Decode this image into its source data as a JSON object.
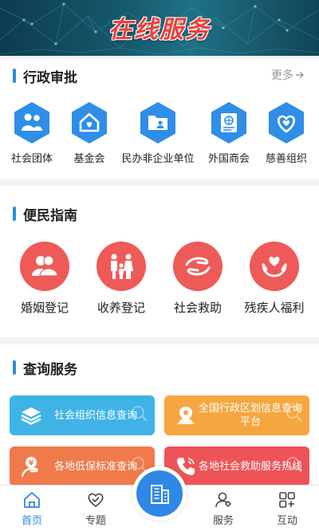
{
  "banner": {
    "title": "在线服务"
  },
  "approval": {
    "title": "行政审批",
    "more": "更多",
    "items": [
      {
        "label": "社会团体",
        "icon": "people-icon"
      },
      {
        "label": "基金会",
        "icon": "house-heart-icon"
      },
      {
        "label": "民办非企业单位",
        "icon": "folder-person-icon"
      },
      {
        "label": "外国商会",
        "icon": "document-globe-icon"
      },
      {
        "label": "慈善组织",
        "icon": "heart-icon"
      }
    ]
  },
  "guide": {
    "title": "便民指南",
    "items": [
      {
        "label": "婚姻登记",
        "icon": "couple-icon"
      },
      {
        "label": "收养登记",
        "icon": "family-icon"
      },
      {
        "label": "社会救助",
        "icon": "helping-hand-icon"
      },
      {
        "label": "残疾人福利",
        "icon": "hand-heart-icon"
      }
    ]
  },
  "query": {
    "title": "查询服务",
    "cards": [
      {
        "label": "社会组织信息查询",
        "color": "#3fb3e6",
        "icon": "layers-icon"
      },
      {
        "label": "全国行政区划信息查询平台",
        "color": "#f5a640",
        "icon": "map-pin-icon"
      },
      {
        "label": "各地低保标准查询",
        "color": "#f07a4a",
        "icon": "person-money-icon"
      },
      {
        "label": "各地社会救助服务热线",
        "color": "#ee5357",
        "icon": "phone-icon"
      }
    ]
  },
  "nav": {
    "items": [
      {
        "label": "首页",
        "icon": "home-icon",
        "active": true
      },
      {
        "label": "专题",
        "icon": "handshake-icon",
        "active": false
      },
      {
        "label": "服务",
        "icon": "person-pin-icon",
        "active": false
      },
      {
        "label": "互动",
        "icon": "apps-icon",
        "active": false
      }
    ],
    "center_icon": "building-icon"
  },
  "colors": {
    "accent": "#2a8ee0",
    "hex": "#2f8ee8",
    "guide": "#ee5a58"
  }
}
